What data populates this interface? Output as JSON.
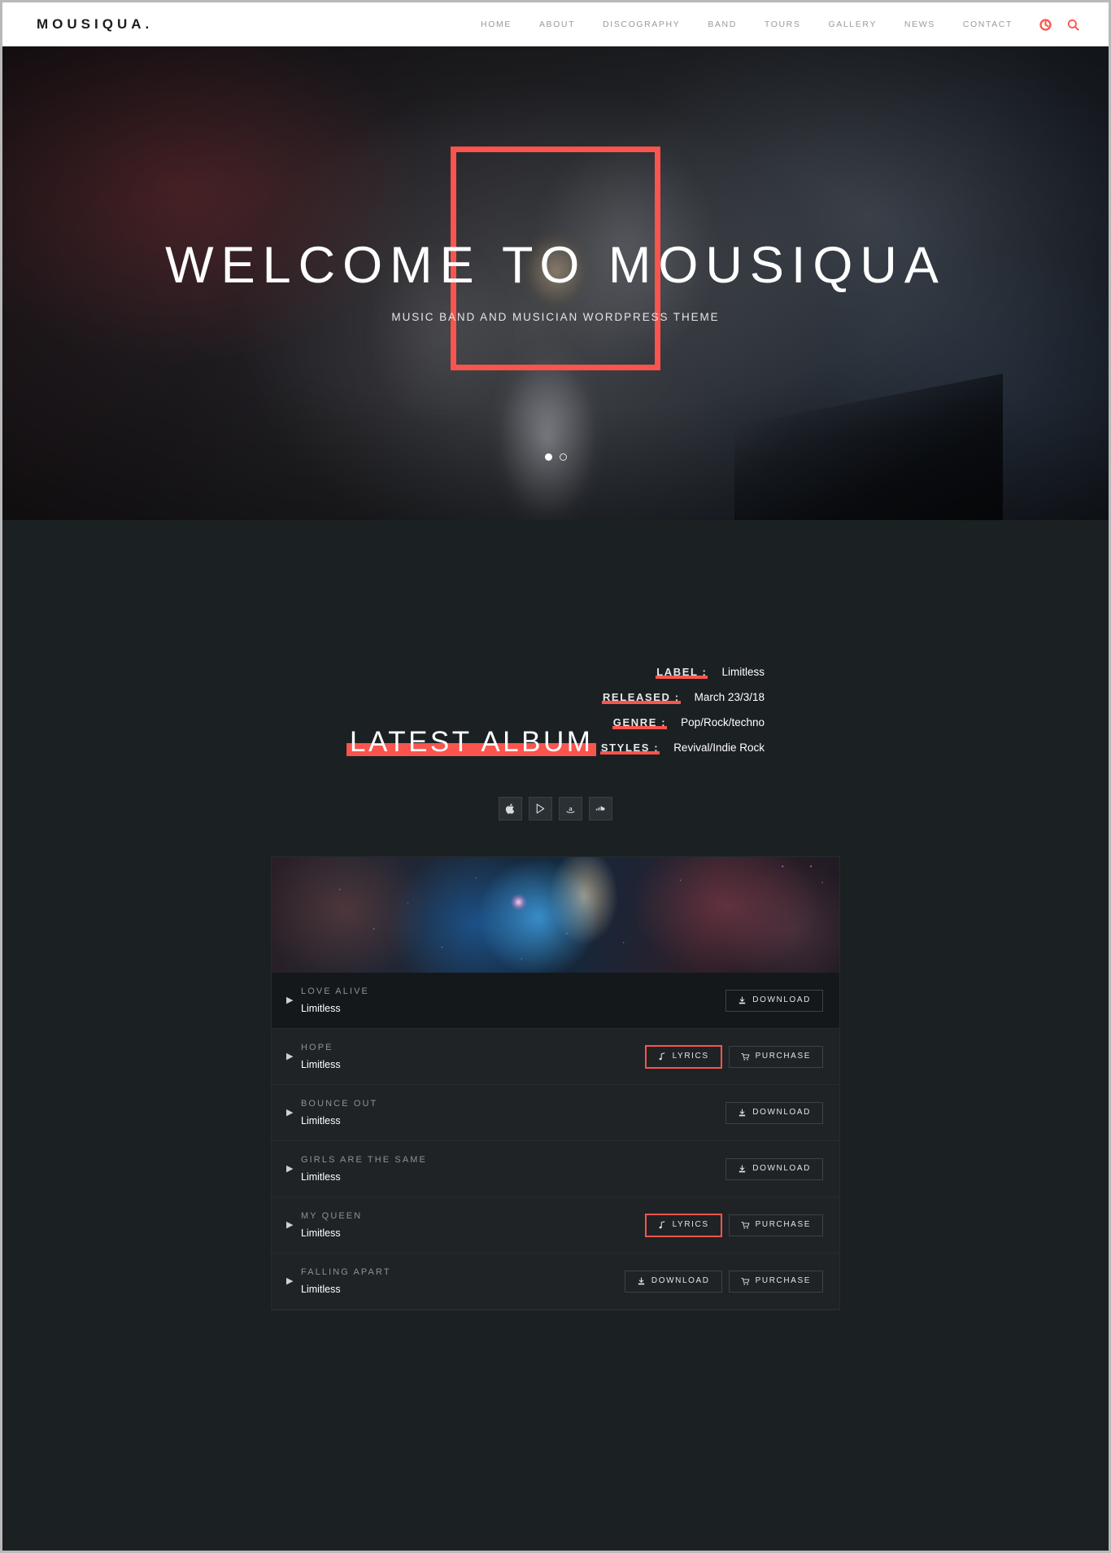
{
  "header": {
    "logo": "MOUSIQUA.",
    "nav": [
      {
        "label": "HOME"
      },
      {
        "label": "ABOUT"
      },
      {
        "label": "DISCOGRAPHY"
      },
      {
        "label": "BAND"
      },
      {
        "label": "TOURS"
      },
      {
        "label": "GALLERY"
      },
      {
        "label": "NEWS"
      },
      {
        "label": "CONTACT"
      }
    ],
    "icons": [
      {
        "name": "cart-icon"
      },
      {
        "name": "search-icon"
      }
    ]
  },
  "hero": {
    "title": "WELCOME TO MOUSIQUA",
    "subtitle": "MUSIC BAND AND MUSICIAN WORDPRESS THEME",
    "slides": [
      {
        "active": true
      },
      {
        "active": false
      }
    ]
  },
  "album": {
    "section_title": "LATEST ALBUM",
    "meta": [
      {
        "label": "LABEL :",
        "value": "Limitless"
      },
      {
        "label": "RELEASED :",
        "value": "March 23/3/18"
      },
      {
        "label": "GENRE :",
        "value": "Pop/Rock/techno"
      },
      {
        "label": "STYLES :",
        "value": "Revival/Indie Rock"
      }
    ],
    "stores": [
      {
        "name": "apple-icon"
      },
      {
        "name": "google-play-icon"
      },
      {
        "name": "amazon-icon"
      },
      {
        "name": "soundcloud-icon"
      }
    ],
    "tracks": [
      {
        "title": "LOVE ALIVE",
        "artist": "Limitless",
        "active": true,
        "actions": [
          {
            "label": "DOWNLOAD",
            "icon": "download-icon",
            "highlight": false
          }
        ]
      },
      {
        "title": "HOPE",
        "artist": "Limitless",
        "active": false,
        "actions": [
          {
            "label": "LYRICS",
            "icon": "music-note-icon",
            "highlight": true
          },
          {
            "label": "PURCHASE",
            "icon": "cart-icon",
            "highlight": false
          }
        ]
      },
      {
        "title": "BOUNCE OUT",
        "artist": "Limitless",
        "active": false,
        "actions": [
          {
            "label": "DOWNLOAD",
            "icon": "download-icon",
            "highlight": false
          }
        ]
      },
      {
        "title": "GIRLS ARE THE SAME",
        "artist": "Limitless",
        "active": false,
        "actions": [
          {
            "label": "DOWNLOAD",
            "icon": "download-icon",
            "highlight": false
          }
        ]
      },
      {
        "title": "MY QUEEN",
        "artist": "Limitless",
        "active": false,
        "actions": [
          {
            "label": "LYRICS",
            "icon": "music-note-icon",
            "highlight": true
          },
          {
            "label": "PURCHASE",
            "icon": "cart-icon",
            "highlight": false
          }
        ]
      },
      {
        "title": "FALLING APART",
        "artist": "Limitless",
        "active": false,
        "actions": [
          {
            "label": "DOWNLOAD",
            "icon": "download-icon",
            "highlight": false
          },
          {
            "label": "PURCHASE",
            "icon": "cart-icon",
            "highlight": false
          }
        ]
      }
    ]
  },
  "colors": {
    "accent": "#f9544d",
    "background": "#1b2023",
    "panel": "#1f2326",
    "header_bg": "#ffffff"
  }
}
